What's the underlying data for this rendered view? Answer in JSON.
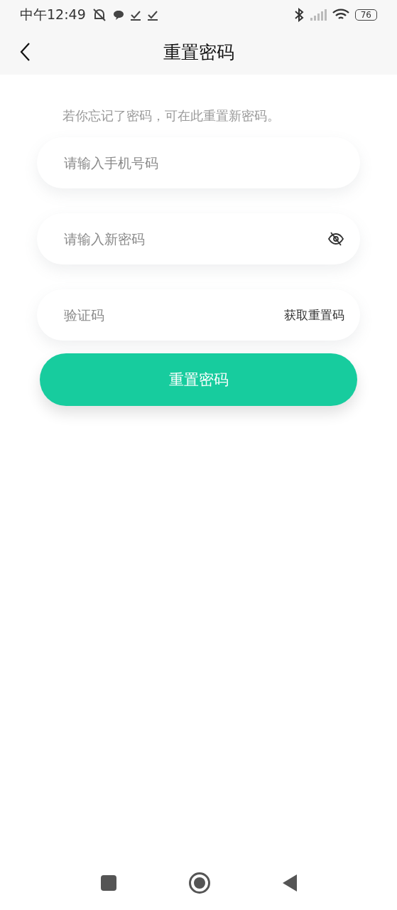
{
  "status_bar": {
    "time": "中午12:49",
    "battery": "76"
  },
  "nav": {
    "title": "重置密码"
  },
  "hint": "若你忘记了密码，可在此重置新密码。",
  "fields": [
    {
      "kind": "phone",
      "placeholder": "请输入手机号码"
    },
    {
      "kind": "password",
      "placeholder": "请输入新密码"
    },
    {
      "kind": "code",
      "placeholder": "验证码",
      "action": "获取重置码"
    }
  ],
  "submit": "重置密码"
}
